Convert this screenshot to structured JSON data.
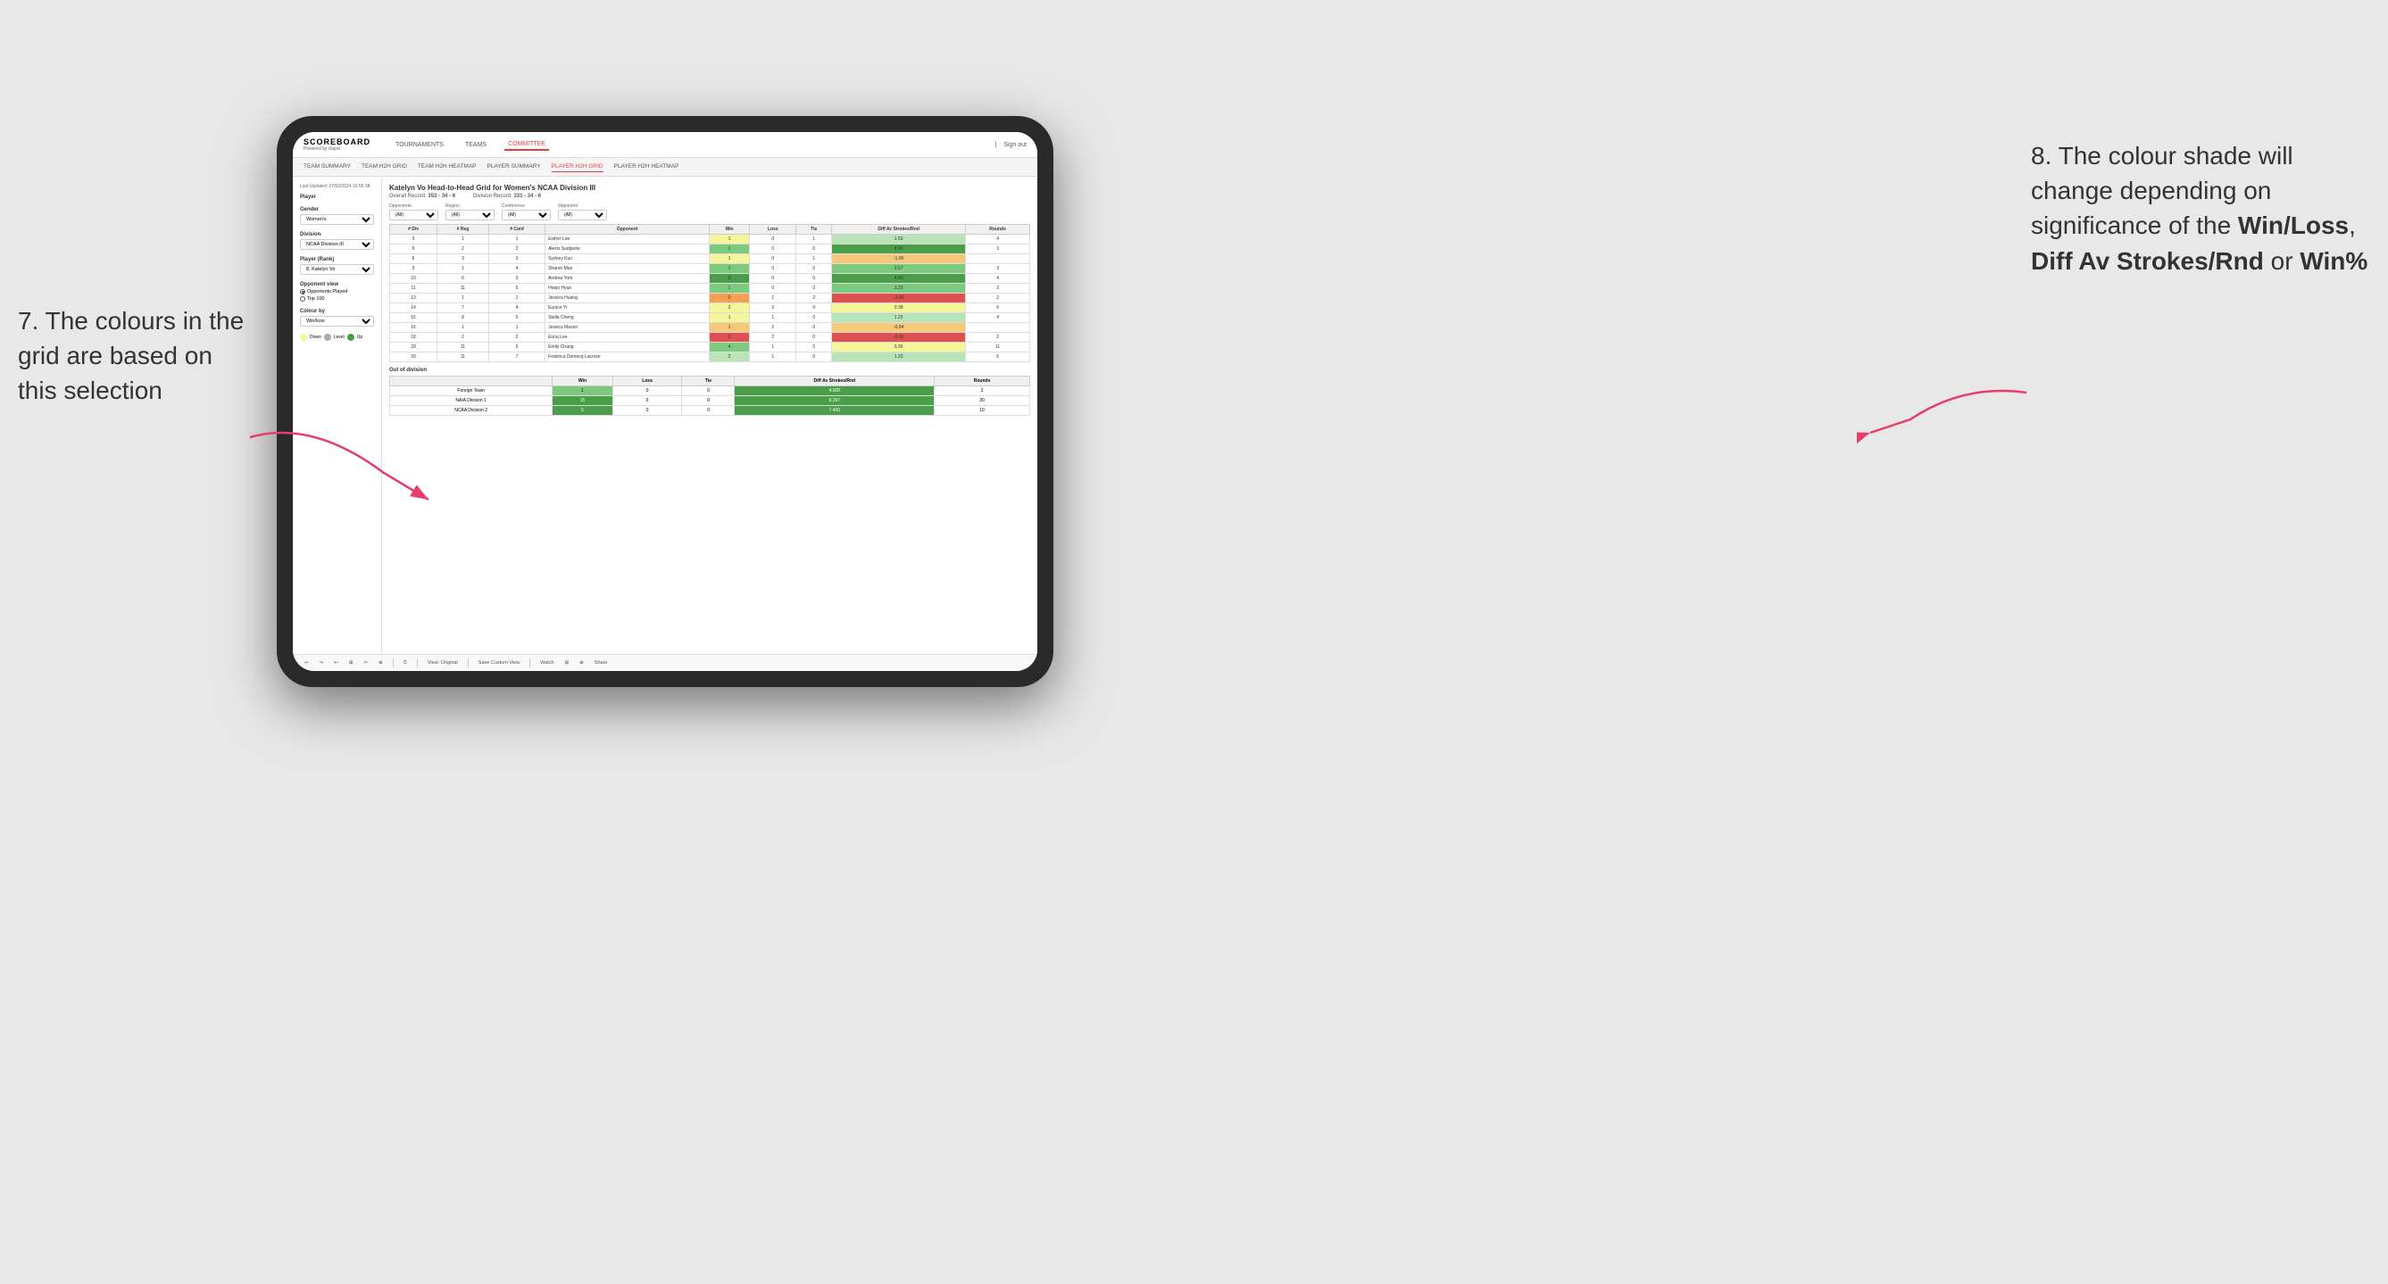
{
  "logo": {
    "title": "SCOREBOARD",
    "subtitle": "Powered by clippd"
  },
  "nav": {
    "items": [
      {
        "label": "TOURNAMENTS",
        "active": false
      },
      {
        "label": "TEAMS",
        "active": false
      },
      {
        "label": "COMMITTEE",
        "active": true
      }
    ],
    "sign_in": "Sign out"
  },
  "sub_nav": {
    "items": [
      {
        "label": "TEAM SUMMARY",
        "active": false
      },
      {
        "label": "TEAM H2H GRID",
        "active": false
      },
      {
        "label": "TEAM H2H HEATMAP",
        "active": false
      },
      {
        "label": "PLAYER SUMMARY",
        "active": false
      },
      {
        "label": "PLAYER H2H GRID",
        "active": true
      },
      {
        "label": "PLAYER H2H HEATMAP",
        "active": false
      }
    ]
  },
  "sidebar": {
    "timestamp": "Last Updated: 27/03/2024 16:55:38",
    "player_section": "Player",
    "gender_label": "Gender",
    "gender_value": "Women's",
    "division_label": "Division",
    "division_value": "NCAA Division III",
    "player_rank_label": "Player (Rank)",
    "player_rank_value": "8. Katelyn Vo",
    "opponent_view_label": "Opponent view",
    "opponents_played": "Opponents Played",
    "top_100": "Top 100",
    "colour_by_label": "Colour by",
    "colour_by_value": "Win/loss",
    "legend_down": "Down",
    "legend_level": "Level",
    "legend_up": "Up"
  },
  "grid": {
    "title": "Katelyn Vo Head-to-Head Grid for Women's NCAA Division III",
    "overall_record_label": "Overall Record:",
    "overall_record": "353 - 34 - 6",
    "division_record_label": "Division Record:",
    "division_record": "331 - 34 - 6",
    "filter_opponents_label": "Opponents:",
    "filter_opponents_value": "(All)",
    "filter_region_label": "Region",
    "filter_region_value": "(All)",
    "filter_conference_label": "Conference",
    "filter_conference_value": "(All)",
    "filter_opponent_label": "Opponent",
    "filter_opponent_value": "(All)",
    "table_headers": [
      "# Div",
      "# Reg",
      "# Conf",
      "Opponent",
      "Win",
      "Loss",
      "Tie",
      "Diff Av Strokes/Rnd",
      "Rounds"
    ],
    "rows": [
      {
        "div": "3",
        "reg": "1",
        "conf": "1",
        "opponent": "Esther Lee",
        "win": 1,
        "loss": 0,
        "tie": 1,
        "diff": 1.5,
        "rounds": 4,
        "win_color": "yellow",
        "diff_color": "green_light"
      },
      {
        "div": "5",
        "reg": "2",
        "conf": "2",
        "opponent": "Alexis Sudjianto",
        "win": 1,
        "loss": 0,
        "tie": 0,
        "diff": 4.0,
        "rounds": 3,
        "win_color": "green_mid",
        "diff_color": "green_dark"
      },
      {
        "div": "6",
        "reg": "3",
        "conf": "3",
        "opponent": "Sydney Kuo",
        "win": 1,
        "loss": 0,
        "tie": 1,
        "diff": -1.0,
        "rounds": "",
        "win_color": "yellow",
        "diff_color": "orange_light"
      },
      {
        "div": "9",
        "reg": "1",
        "conf": "4",
        "opponent": "Sharon Mun",
        "win": 1,
        "loss": 0,
        "tie": 0,
        "diff": 3.67,
        "rounds": 3,
        "win_color": "green_mid",
        "diff_color": "green_dark"
      },
      {
        "div": "10",
        "reg": "6",
        "conf": "3",
        "opponent": "Andrea York",
        "win": 2,
        "loss": 0,
        "tie": 0,
        "diff": 4.0,
        "rounds": 4,
        "win_color": "green_dark",
        "diff_color": "green_dark"
      },
      {
        "div": "11",
        "reg": "11",
        "conf": "5",
        "opponent": "Heejo Hyun",
        "win": 1,
        "loss": 0,
        "tie": 0,
        "diff": 3.33,
        "rounds": 3,
        "win_color": "green_mid",
        "diff_color": "green_dark"
      },
      {
        "div": "13",
        "reg": "1",
        "conf": "1",
        "opponent": "Jessica Huang",
        "win": 0,
        "loss": 1,
        "tie": 2,
        "diff": -3.0,
        "rounds": 2,
        "win_color": "orange",
        "diff_color": "red"
      },
      {
        "div": "14",
        "reg": "7",
        "conf": "4",
        "opponent": "Eunice Yi",
        "win": 2,
        "loss": 2,
        "tie": 0,
        "diff": 0.38,
        "rounds": 9,
        "win_color": "yellow",
        "diff_color": "yellow"
      },
      {
        "div": "15",
        "reg": "8",
        "conf": "5",
        "opponent": "Stella Cheng",
        "win": 1,
        "loss": 1,
        "tie": 0,
        "diff": 1.25,
        "rounds": 4,
        "win_color": "yellow",
        "diff_color": "green_light"
      },
      {
        "div": "16",
        "reg": "1",
        "conf": "1",
        "opponent": "Jessica Mason",
        "win": 1,
        "loss": 2,
        "tie": 0,
        "diff": -0.94,
        "rounds": "",
        "win_color": "orange_light",
        "diff_color": "orange_light"
      },
      {
        "div": "18",
        "reg": "2",
        "conf": "2",
        "opponent": "Euna Lee",
        "win": 0,
        "loss": 2,
        "tie": 0,
        "diff": -5.0,
        "rounds": 2,
        "win_color": "red",
        "diff_color": "red"
      },
      {
        "div": "20",
        "reg": "11",
        "conf": "6",
        "opponent": "Emily Chang",
        "win": 4,
        "loss": 1,
        "tie": 0,
        "diff": 0.3,
        "rounds": 11,
        "win_color": "green_mid",
        "diff_color": "yellow"
      },
      {
        "div": "20",
        "reg": "11",
        "conf": "7",
        "opponent": "Federica Domecq Lacroze",
        "win": 2,
        "loss": 1,
        "tie": 0,
        "diff": 1.33,
        "rounds": 6,
        "win_color": "green_light",
        "diff_color": "green_light"
      }
    ],
    "out_of_division_label": "Out of division",
    "out_of_division_rows": [
      {
        "label": "Foreign Team",
        "win": 1,
        "loss": 0,
        "tie": 0,
        "diff": 4.5,
        "rounds": 2
      },
      {
        "label": "NAIA Division 1",
        "win": 15,
        "loss": 0,
        "tie": 0,
        "diff": 9.267,
        "rounds": 30
      },
      {
        "label": "NCAA Division 2",
        "win": 5,
        "loss": 0,
        "tie": 0,
        "diff": 7.4,
        "rounds": 10
      }
    ]
  },
  "toolbar": {
    "view_original": "View: Original",
    "save_custom": "Save Custom View",
    "watch": "Watch",
    "share": "Share"
  },
  "annotations": {
    "left_number": "7.",
    "left_text": "The colours in the grid are based on this selection",
    "right_number": "8.",
    "right_text1": "The colour shade will change depending on significance of the ",
    "right_bold1": "Win/Loss",
    "right_text2": ", ",
    "right_bold2": "Diff Av Strokes/Rnd",
    "right_text3": " or ",
    "right_bold3": "Win%"
  }
}
